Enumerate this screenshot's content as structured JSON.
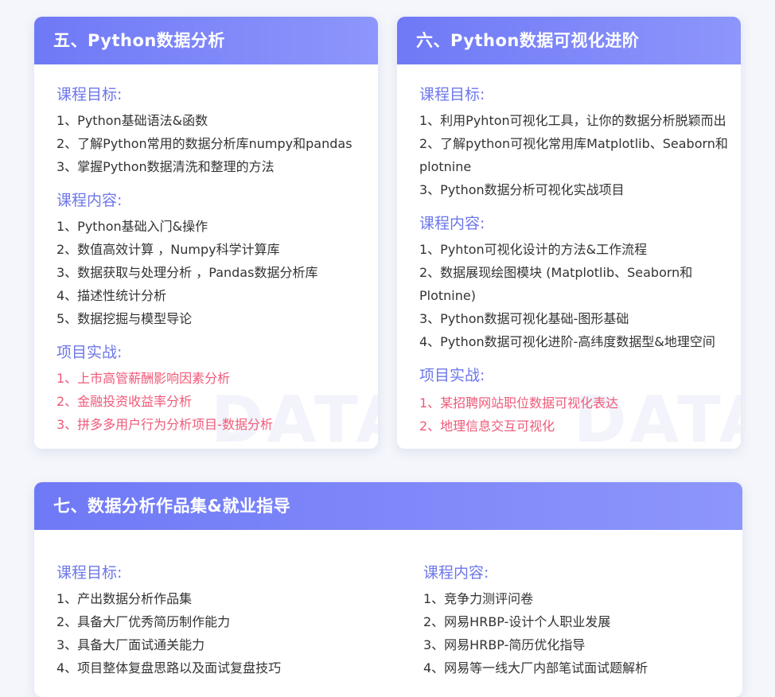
{
  "card5": {
    "title": "五、Python数据分析",
    "goals_title": "课程目标:",
    "goals": [
      "1、Python基础语法&函数",
      "2、了解Python常用的数据分析库numpy和pandas",
      "3、掌握Python数据清洗和整理的方法"
    ],
    "content_title": "课程内容:",
    "content": [
      "1、Python基础入门&操作",
      "2、数值高效计算 ，Numpy科学计算库",
      "3、数据获取与处理分析 ，Pandas数据分析库",
      "4、描述性统计分析",
      "5、数据挖掘与模型导论"
    ],
    "project_title": "项目实战:",
    "projects": [
      "1、上市高管薪酬影响因素分析",
      "2、金融投资收益率分析",
      "3、拼多多用户行为分析项目-数据分析"
    ]
  },
  "card6": {
    "title": "六、Python数据可视化进阶",
    "goals_title": "课程目标:",
    "goals": [
      "1、利用Pyhton可视化工具，让你的数据分析脱颖而出",
      "2、了解python可视化常用库Matplotlib、Seaborn和plotnine",
      "3、Python数据分析可视化实战项目"
    ],
    "content_title": "课程内容:",
    "content": [
      "1、Pyhton可视化设计的方法&工作流程",
      "2、数据展现绘图模块 (Matplotlib、Seaborn和Plotnine)",
      "3、Python数据可视化基础-图形基础",
      "4、Python数据可视化进阶-高纬度数据型&地理空间"
    ],
    "project_title": "项目实战:",
    "projects": [
      "1、某招聘网站职位数据可视化表达",
      "2、地理信息交互可视化"
    ]
  },
  "card7": {
    "title": "七、数据分析作品集&就业指导",
    "goals_title": "课程目标:",
    "goals": [
      "1、产出数据分析作品集",
      "2、具备大厂优秀简历制作能力",
      "3、具备大厂面试通关能力",
      "4、项目整体复盘思路以及面试复盘技巧"
    ],
    "content_title": "课程内容:",
    "content": [
      "1、竞争力测评问卷",
      "2、网易HRBP-设计个人职业发展",
      "3、网易HRBP-简历优化指导",
      "4、网易等一线大厂内部笔试面试题解析"
    ]
  },
  "watermark": "DATA",
  "colors": {
    "header_start": "#6f79f6",
    "header_end": "#8d96fb",
    "section_title": "#6d77ea",
    "project_text": "#ef5a78",
    "body_text": "#333333"
  }
}
